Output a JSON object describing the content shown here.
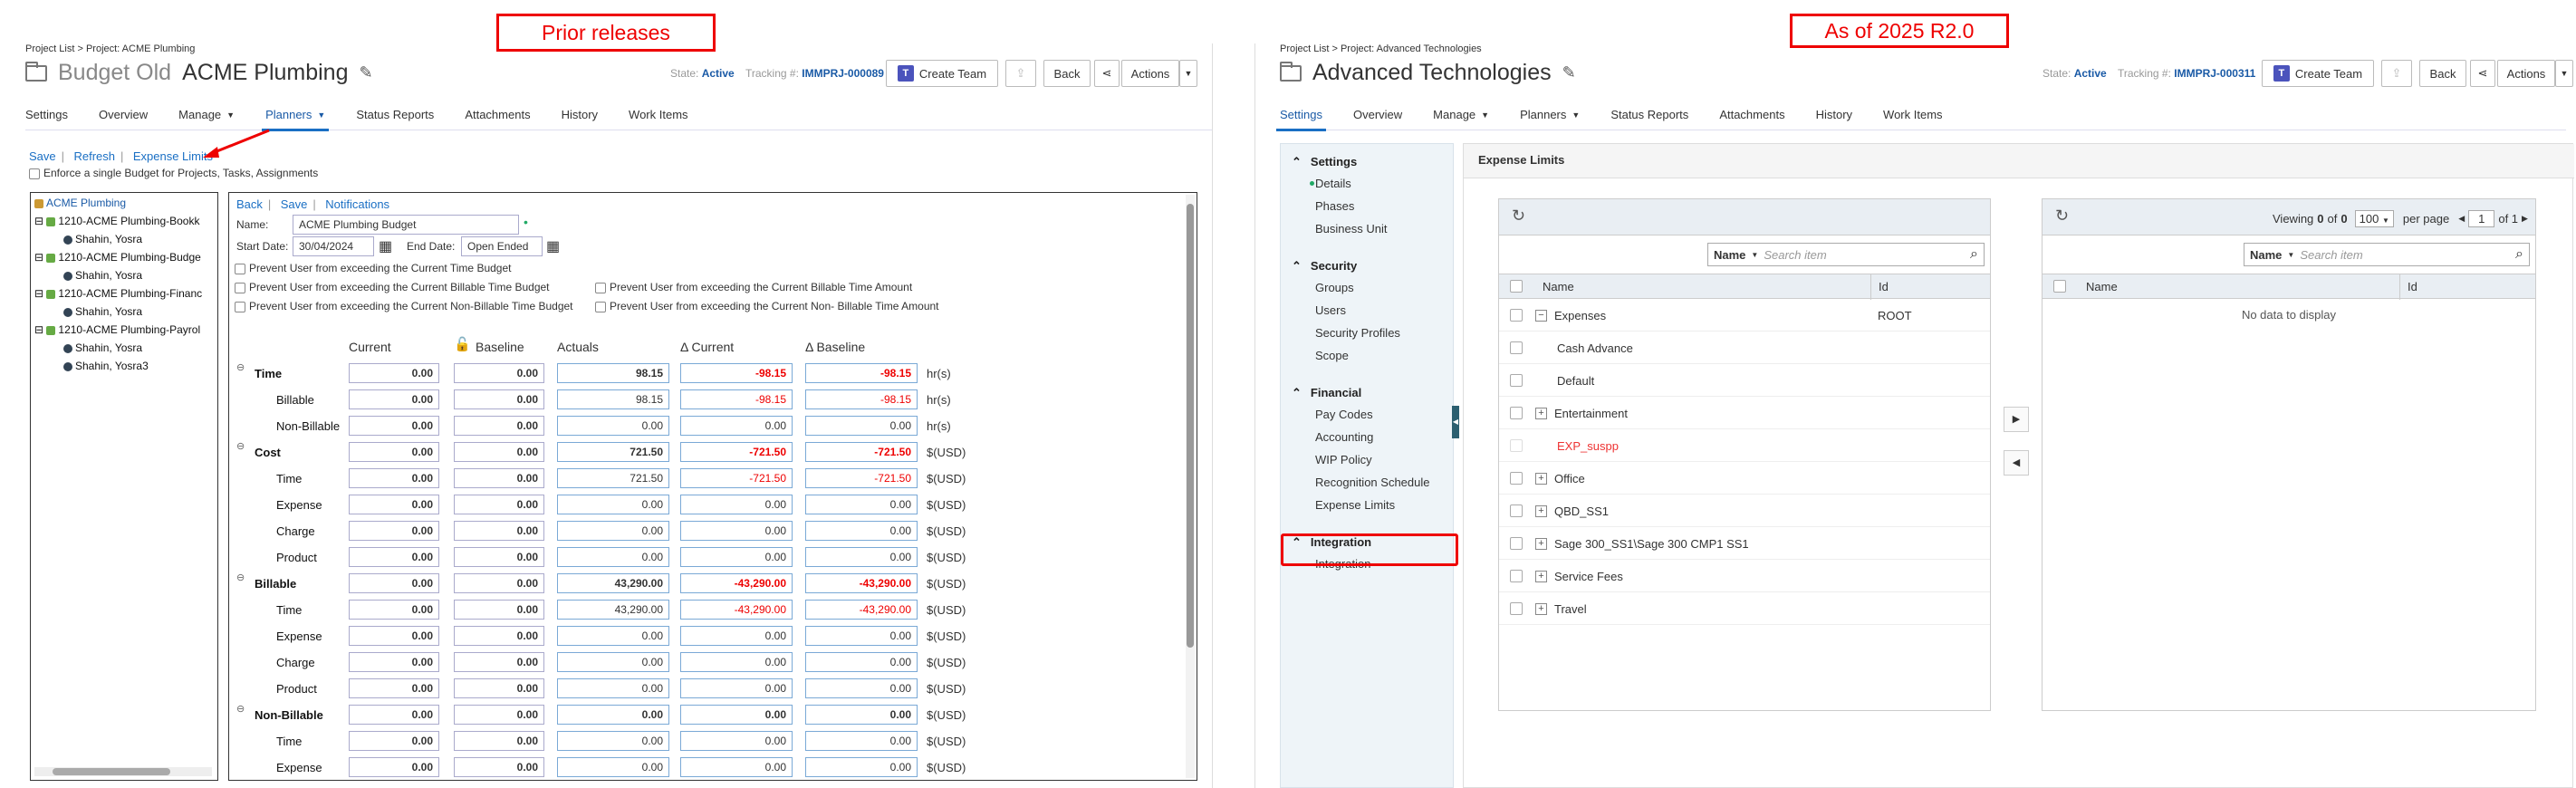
{
  "callouts": {
    "left": "Prior releases",
    "right": "As of 2025 R2.0"
  },
  "left": {
    "breadcrumb": "Project List > Project: ACME Plumbing",
    "title_prefix": "Budget Old",
    "title": "ACME Plumbing",
    "state_label": "State:",
    "state_value": "Active",
    "tracking_label": "Tracking #:",
    "tracking_value": "IMMPRJ-000089",
    "create_team": "Create Team",
    "back": "Back",
    "actions": "Actions",
    "tabs": [
      "Settings",
      "Overview",
      "Manage",
      "Planners",
      "Status Reports",
      "Attachments",
      "History",
      "Work Items"
    ],
    "links": {
      "save": "Save",
      "refresh": "Refresh",
      "expense_limits": "Expense Limits"
    },
    "enforce": "Enforce a single Budget for Projects, Tasks, Assignments",
    "tree": [
      "ACME Plumbing",
      "1210-ACME Plumbing-Bookk",
      "Shahin, Yosra",
      "1210-ACME Plumbing-Budge",
      "Shahin, Yosra",
      "1210-ACME Plumbing-Financ",
      "Shahin, Yosra",
      "1210-ACME Plumbing-Payrol",
      "Shahin, Yosra",
      "Shahin, Yosra3"
    ],
    "detail_links": {
      "back": "Back",
      "save": "Save",
      "notifications": "Notifications"
    },
    "name_label": "Name:",
    "name_value": "ACME Plumbing Budget",
    "start_label": "Start Date:",
    "start_value": "30/04/2024",
    "end_label": "End Date:",
    "end_value": "Open Ended",
    "prevent": [
      "Prevent User from exceeding the Current Time Budget",
      "Prevent User from exceeding the Current Billable Time Budget",
      "Prevent User from exceeding the Current Billable Time Amount",
      "Prevent User from exceeding the Current Non-Billable Time Budget",
      "Prevent User from exceeding the Current Non- Billable Time Amount"
    ],
    "columns": [
      "Current",
      "Baseline",
      "Actuals",
      "Δ Current",
      "Δ Baseline"
    ],
    "rows": [
      {
        "label": "Time",
        "bold": true,
        "vals": [
          "0.00",
          "0.00",
          "98.15",
          "-98.15",
          "-98.15"
        ],
        "unit": "hr(s)"
      },
      {
        "label": "Billable",
        "bold": false,
        "vals": [
          "0.00",
          "0.00",
          "98.15",
          "-98.15",
          "-98.15"
        ],
        "unit": "hr(s)"
      },
      {
        "label": "Non-Billable",
        "bold": false,
        "vals": [
          "0.00",
          "0.00",
          "0.00",
          "0.00",
          "0.00"
        ],
        "unit": "hr(s)"
      },
      {
        "label": "Cost",
        "bold": true,
        "vals": [
          "0.00",
          "0.00",
          "721.50",
          "-721.50",
          "-721.50"
        ],
        "unit": "$(USD)"
      },
      {
        "label": "Time",
        "bold": false,
        "vals": [
          "0.00",
          "0.00",
          "721.50",
          "-721.50",
          "-721.50"
        ],
        "unit": "$(USD)"
      },
      {
        "label": "Expense",
        "bold": false,
        "vals": [
          "0.00",
          "0.00",
          "0.00",
          "0.00",
          "0.00"
        ],
        "unit": "$(USD)"
      },
      {
        "label": "Charge",
        "bold": false,
        "vals": [
          "0.00",
          "0.00",
          "0.00",
          "0.00",
          "0.00"
        ],
        "unit": "$(USD)"
      },
      {
        "label": "Product",
        "bold": false,
        "vals": [
          "0.00",
          "0.00",
          "0.00",
          "0.00",
          "0.00"
        ],
        "unit": "$(USD)"
      },
      {
        "label": "Billable",
        "bold": true,
        "vals": [
          "0.00",
          "0.00",
          "43,290.00",
          "-43,290.00",
          "-43,290.00"
        ],
        "unit": "$(USD)"
      },
      {
        "label": "Time",
        "bold": false,
        "vals": [
          "0.00",
          "0.00",
          "43,290.00",
          "-43,290.00",
          "-43,290.00"
        ],
        "unit": "$(USD)"
      },
      {
        "label": "Expense",
        "bold": false,
        "vals": [
          "0.00",
          "0.00",
          "0.00",
          "0.00",
          "0.00"
        ],
        "unit": "$(USD)"
      },
      {
        "label": "Charge",
        "bold": false,
        "vals": [
          "0.00",
          "0.00",
          "0.00",
          "0.00",
          "0.00"
        ],
        "unit": "$(USD)"
      },
      {
        "label": "Product",
        "bold": false,
        "vals": [
          "0.00",
          "0.00",
          "0.00",
          "0.00",
          "0.00"
        ],
        "unit": "$(USD)"
      },
      {
        "label": "Non-Billable",
        "bold": true,
        "vals": [
          "0.00",
          "0.00",
          "0.00",
          "0.00",
          "0.00"
        ],
        "unit": "$(USD)"
      },
      {
        "label": "Time",
        "bold": false,
        "vals": [
          "0.00",
          "0.00",
          "0.00",
          "0.00",
          "0.00"
        ],
        "unit": "$(USD)"
      },
      {
        "label": "Expense",
        "bold": false,
        "vals": [
          "0.00",
          "0.00",
          "0.00",
          "0.00",
          "0.00"
        ],
        "unit": "$(USD)"
      }
    ]
  },
  "right": {
    "breadcrumb": "Project List > Project: Advanced Technologies",
    "title": "Advanced Technologies",
    "state_label": "State:",
    "state_value": "Active",
    "tracking_label": "Tracking #:",
    "tracking_value": "IMMPRJ-000311",
    "create_team": "Create Team",
    "back": "Back",
    "actions": "Actions",
    "tabs": [
      "Settings",
      "Overview",
      "Manage",
      "Planners",
      "Status Reports",
      "Attachments",
      "History",
      "Work Items"
    ],
    "nav": [
      {
        "group": "Settings",
        "items": [
          "Details",
          "Phases",
          "Business Unit"
        ]
      },
      {
        "group": "Security",
        "items": [
          "Groups",
          "Users",
          "Security Profiles",
          "Scope"
        ]
      },
      {
        "group": "Financial",
        "items": [
          "Pay Codes",
          "Accounting",
          "WIP Policy",
          "Recognition Schedule",
          "Expense Limits"
        ]
      },
      {
        "group": "Integration",
        "items": [
          "Integration"
        ]
      }
    ],
    "content_title": "Expense Limits",
    "search_field": "Name",
    "search_placeholder": "Search item",
    "col_name": "Name",
    "col_id": "Id",
    "left_rows": [
      {
        "label": "Expenses",
        "id": "ROOT",
        "expand": "−",
        "red": false
      },
      {
        "label": "Cash Advance",
        "id": "",
        "expand": "",
        "red": false
      },
      {
        "label": "Default",
        "id": "",
        "expand": "",
        "red": false
      },
      {
        "label": "Entertainment",
        "id": "",
        "expand": "+",
        "red": false
      },
      {
        "label": "EXP_suspp",
        "id": "",
        "expand": "",
        "red": true
      },
      {
        "label": "Office",
        "id": "",
        "expand": "+",
        "red": false
      },
      {
        "label": "QBD_SS1",
        "id": "",
        "expand": "+",
        "red": false
      },
      {
        "label": "Sage 300_SS1\\Sage 300 CMP1 SS1",
        "id": "",
        "expand": "+",
        "red": false
      },
      {
        "label": "Service Fees",
        "id": "",
        "expand": "+",
        "red": false
      },
      {
        "label": "Travel",
        "id": "",
        "expand": "+",
        "red": false
      }
    ],
    "viewing": "Viewing",
    "viewing_from": "0",
    "of": "of",
    "viewing_total": "0",
    "page_size": "100",
    "per_page": "per page",
    "page": "1",
    "page_of": "of 1",
    "no_data": "No data to display"
  }
}
